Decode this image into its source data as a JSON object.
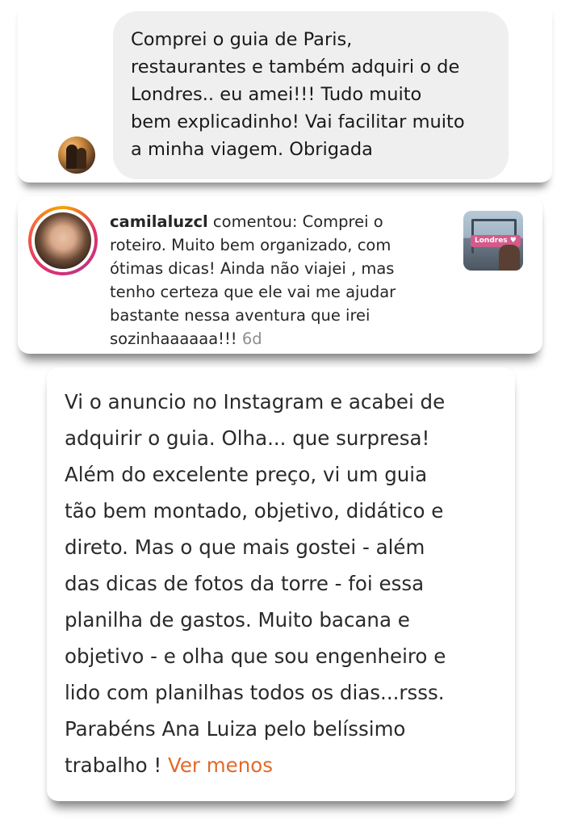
{
  "chat": {
    "message_lines": [
      "Comprei o guia de Paris,",
      "restaurantes e também adquiri o de",
      "Londres.. eu amei!!! Tudo muito",
      "bem explicadinho! Vai facilitar muito",
      "a minha viagem. Obrigada"
    ]
  },
  "comment": {
    "username": "camilaluzcl",
    "text_lines": [
      " comentou: Comprei o",
      "roteiro. Muito bem organizado, com",
      "ótimas dicas! Ainda não viajei , mas",
      "tenho certeza que ele vai me ajudar",
      "bastante nessa aventura que irei",
      "sozinhaaaaaa!!! "
    ],
    "time": "6d",
    "thumbnail_tag": "Londres ♥"
  },
  "review": {
    "text_lines": [
      "Vi o anuncio no Instagram e acabei de",
      "adquirir o guia. Olha... que surpresa!",
      "Além do excelente preço, vi um guia",
      "tão bem montado, objetivo, didático e",
      "direto. Mas o que mais gostei - além",
      "das dicas de fotos da torre - foi essa",
      "planilha de gastos. Muito bacana e",
      "objetivo - e olha que sou engenheiro e",
      "lido com planilhas todos os dias...rsss.",
      "Parabéns Ana Luiza pelo belíssimo",
      "trabalho ! "
    ],
    "see_less": "Ver menos"
  },
  "colors": {
    "bubble_bg": "#efefef",
    "link_orange": "#e06a2c",
    "timestamp_gray": "#8e8e8e"
  }
}
